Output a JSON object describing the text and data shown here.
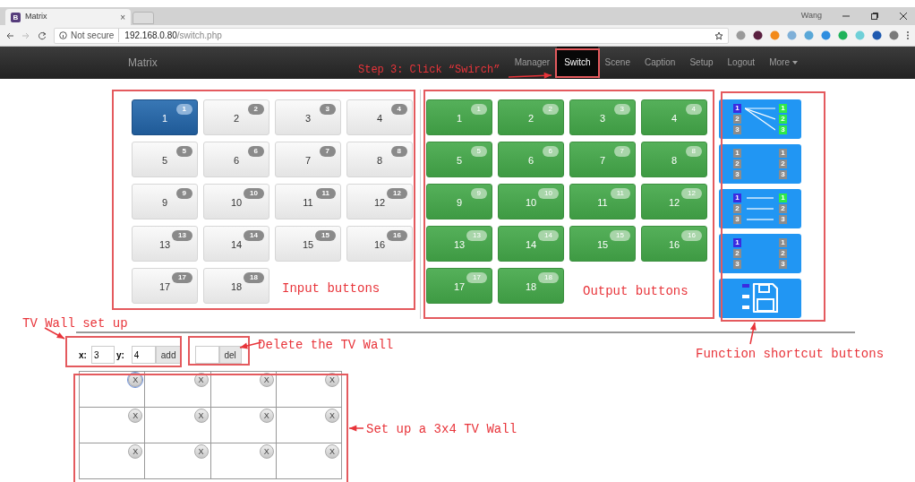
{
  "browser": {
    "tab_title": "Matrix",
    "tab_icon": "B",
    "tab_close": "×",
    "profile": "Wang",
    "security": "Not secure",
    "url_host": "192.168.0.80",
    "url_path": "/switch.php"
  },
  "navbar": {
    "brand": "Matrix",
    "items": [
      {
        "label": "Manager",
        "selected": false,
        "dropdown": false
      },
      {
        "label": "Switch",
        "selected": true,
        "dropdown": false
      },
      {
        "label": "Scene",
        "selected": false,
        "dropdown": false
      },
      {
        "label": "Caption",
        "selected": false,
        "dropdown": false
      },
      {
        "label": "Setup",
        "selected": false,
        "dropdown": false
      },
      {
        "label": "Logout",
        "selected": false,
        "dropdown": false
      },
      {
        "label": "More",
        "selected": false,
        "dropdown": true
      }
    ]
  },
  "input_buttons": [
    {
      "label": "1",
      "badge": "1",
      "selected": true
    },
    {
      "label": "2",
      "badge": "2",
      "selected": false
    },
    {
      "label": "3",
      "badge": "3",
      "selected": false
    },
    {
      "label": "4",
      "badge": "4",
      "selected": false
    },
    {
      "label": "5",
      "badge": "5",
      "selected": false
    },
    {
      "label": "6",
      "badge": "6",
      "selected": false
    },
    {
      "label": "7",
      "badge": "7",
      "selected": false
    },
    {
      "label": "8",
      "badge": "8",
      "selected": false
    },
    {
      "label": "9",
      "badge": "9",
      "selected": false
    },
    {
      "label": "10",
      "badge": "10",
      "selected": false
    },
    {
      "label": "11",
      "badge": "11",
      "selected": false
    },
    {
      "label": "12",
      "badge": "12",
      "selected": false
    },
    {
      "label": "13",
      "badge": "13",
      "selected": false
    },
    {
      "label": "14",
      "badge": "14",
      "selected": false
    },
    {
      "label": "15",
      "badge": "15",
      "selected": false
    },
    {
      "label": "16",
      "badge": "16",
      "selected": false
    },
    {
      "label": "17",
      "badge": "17",
      "selected": false
    },
    {
      "label": "18",
      "badge": "18",
      "selected": false
    }
  ],
  "output_buttons": [
    {
      "label": "1",
      "badge": "1",
      "selected": true
    },
    {
      "label": "2",
      "badge": "2",
      "selected": true
    },
    {
      "label": "3",
      "badge": "3",
      "selected": true
    },
    {
      "label": "4",
      "badge": "4",
      "selected": true
    },
    {
      "label": "5",
      "badge": "5",
      "selected": true
    },
    {
      "label": "6",
      "badge": "6",
      "selected": true
    },
    {
      "label": "7",
      "badge": "7",
      "selected": true
    },
    {
      "label": "8",
      "badge": "8",
      "selected": true
    },
    {
      "label": "9",
      "badge": "9",
      "selected": true
    },
    {
      "label": "10",
      "badge": "10",
      "selected": true
    },
    {
      "label": "11",
      "badge": "11",
      "selected": true
    },
    {
      "label": "12",
      "badge": "12",
      "selected": true
    },
    {
      "label": "13",
      "badge": "13",
      "selected": true
    },
    {
      "label": "14",
      "badge": "14",
      "selected": true
    },
    {
      "label": "15",
      "badge": "15",
      "selected": true
    },
    {
      "label": "16",
      "badge": "16",
      "selected": true
    },
    {
      "label": "17",
      "badge": "17",
      "selected": true
    },
    {
      "label": "18",
      "badge": "18",
      "selected": true
    }
  ],
  "function_buttons": [
    {
      "kind": "one-to-all",
      "left": [
        {
          "text": "1",
          "color": "#3a2be0"
        },
        {
          "text": "2",
          "color": "#8c8c8c"
        },
        {
          "text": "3",
          "color": "#8c8c8c"
        }
      ],
      "right": [
        {
          "text": "1",
          "color": "#2ee84a"
        },
        {
          "text": "2",
          "color": "#2ee84a"
        },
        {
          "text": "3",
          "color": "#2ee84a"
        }
      ]
    },
    {
      "kind": "plain",
      "left": [
        {
          "text": "1",
          "color": "#8c8c8c"
        },
        {
          "text": "2",
          "color": "#8c8c8c"
        },
        {
          "text": "3",
          "color": "#8c8c8c"
        }
      ],
      "right": [
        {
          "text": "1",
          "color": "#8c8c8c"
        },
        {
          "text": "2",
          "color": "#8c8c8c"
        },
        {
          "text": "3",
          "color": "#8c8c8c"
        }
      ]
    },
    {
      "kind": "one-to-one",
      "left": [
        {
          "text": "1",
          "color": "#3a2be0"
        },
        {
          "text": "2",
          "color": "#8c8c8c"
        },
        {
          "text": "3",
          "color": "#8c8c8c"
        }
      ],
      "right": [
        {
          "text": "1",
          "color": "#2ee84a"
        },
        {
          "text": "2",
          "color": "#8c8c8c"
        },
        {
          "text": "3",
          "color": "#8c8c8c"
        }
      ]
    },
    {
      "kind": "plain",
      "left": [
        {
          "text": "1",
          "color": "#3a2be0"
        },
        {
          "text": "2",
          "color": "#8c8c8c"
        },
        {
          "text": "3",
          "color": "#8c8c8c"
        }
      ],
      "right": [
        {
          "text": "1",
          "color": "#8c8c8c"
        },
        {
          "text": "2",
          "color": "#8c8c8c"
        },
        {
          "text": "3",
          "color": "#8c8c8c"
        }
      ]
    },
    {
      "kind": "save"
    }
  ],
  "tv_wall": {
    "x_label": "x:",
    "x_value": "3",
    "y_label": "y:",
    "y_value": "4",
    "add": "add",
    "del": "del",
    "cells": [
      {
        "close": "X",
        "focused": true
      },
      {
        "close": "X",
        "focused": false
      },
      {
        "close": "X",
        "focused": false
      },
      {
        "close": "X",
        "focused": false
      },
      {
        "close": "X",
        "focused": false
      },
      {
        "close": "X",
        "focused": false
      },
      {
        "close": "X",
        "focused": false
      },
      {
        "close": "X",
        "focused": false
      },
      {
        "close": "X",
        "focused": false
      },
      {
        "close": "X",
        "focused": false
      },
      {
        "close": "X",
        "focused": false
      },
      {
        "close": "X",
        "focused": false
      }
    ]
  },
  "annotations": {
    "step": "Step 3: Click “Swirch”",
    "input_buttons": "Input buttons",
    "output_buttons": "Output buttons",
    "tv_wall_setup": "TV Wall set up",
    "delete": "Delete the TV Wall",
    "functions": "Function shortcut buttons",
    "grid": "Set up a 3x4 TV Wall"
  }
}
